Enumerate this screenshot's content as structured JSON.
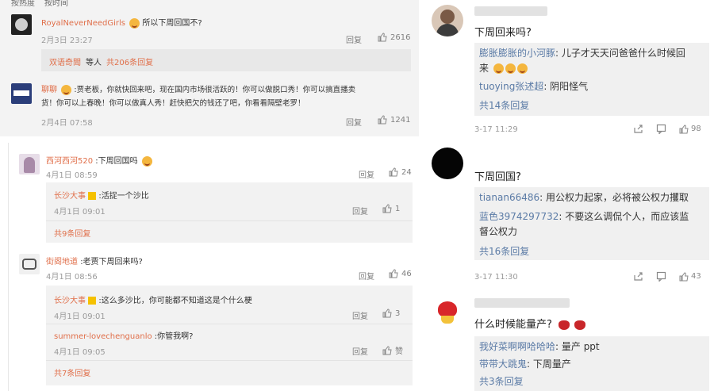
{
  "top_left": {
    "tabs": [
      "按热度",
      "按时间"
    ],
    "comments": [
      {
        "user": "RoyalNeverNeedGirls",
        "text": "所以下周回国不?",
        "time": "2月3日 23:27",
        "reply_label": "回复",
        "likes": "2616",
        "sub_line": {
          "user": "双语奇聞",
          "text": "等人",
          "link": "共206条回复"
        }
      },
      {
        "user": "聊聊",
        "text_line1": ":贾老板，你就快回来吧，现在国内市场很活跃的！你可以做脱口秀！你可以搞直播卖",
        "text_line2": "货！你可以上春晚！你可以做真人秀！赶快把欠的钱还了吧，你看看隔壁老罗！",
        "time": "2月4日 07:58",
        "reply_label": "回复",
        "likes": "1241"
      }
    ]
  },
  "bottom_left": {
    "comments": [
      {
        "user": "西河西河520",
        "text": ":下周回国吗",
        "time": "4月1日 08:59",
        "reply_label": "回复",
        "likes": "24",
        "replies": [
          {
            "user": "长沙大事",
            "text": ":活捉一个沙比",
            "time": "4月1日 09:01",
            "reply_label": "回复",
            "likes": "1"
          }
        ],
        "more": "共9条回复"
      },
      {
        "user": "街阁地道",
        "text": ":老贾下周回来吗?",
        "time": "4月1日 08:56",
        "reply_label": "回复",
        "likes": "46",
        "replies": [
          {
            "user": "长沙大事",
            "text": ":这么多沙比，你可能都不知道这是个什么梗",
            "time": "4月1日 09:01",
            "reply_label": "回复",
            "likes": "3"
          },
          {
            "user": "summer-lovechenguanlo",
            "text": ":你管我啊?",
            "time": "4月1日 09:05",
            "reply_label": "回复",
            "likes": "赞"
          }
        ],
        "more": "共7条回复"
      }
    ]
  },
  "right": {
    "comments": [
      {
        "text": "下周回来吗?",
        "replies": [
          {
            "user": "膨胀膨胀的小河豚",
            "text_a": ": 儿子才天天问爸爸什么时候回",
            "text_b": "来"
          },
          {
            "user": "tuoying张述超",
            "text": ": 阴阳怪气"
          }
        ],
        "more": "共14条回复",
        "time": "3-17 11:29",
        "likes": "98"
      },
      {
        "text": "下周回国?",
        "replies": [
          {
            "user": "tianan66486",
            "text": ": 用公权力起家，必将被公权力攫取"
          },
          {
            "user": "蓝色3974297732",
            "text_a": ": 不要这么调侃个人，而应该监",
            "text_b": "督公权力"
          }
        ],
        "more": "共16条回复",
        "time": "3-17 11:30",
        "likes": "43"
      },
      {
        "text": "什么时候能量产?",
        "replies": [
          {
            "user": "我好菜啊啊哈哈哈",
            "text": ": 量产 ppt"
          },
          {
            "user": "带带大跳鬼",
            "text": ": 下周量产"
          }
        ],
        "more": "共3条回复"
      }
    ]
  },
  "colors": {
    "link_blue": "#5b7ba6",
    "orange_name": "#e06f4a",
    "reply_bg": "#f2f2f2"
  }
}
